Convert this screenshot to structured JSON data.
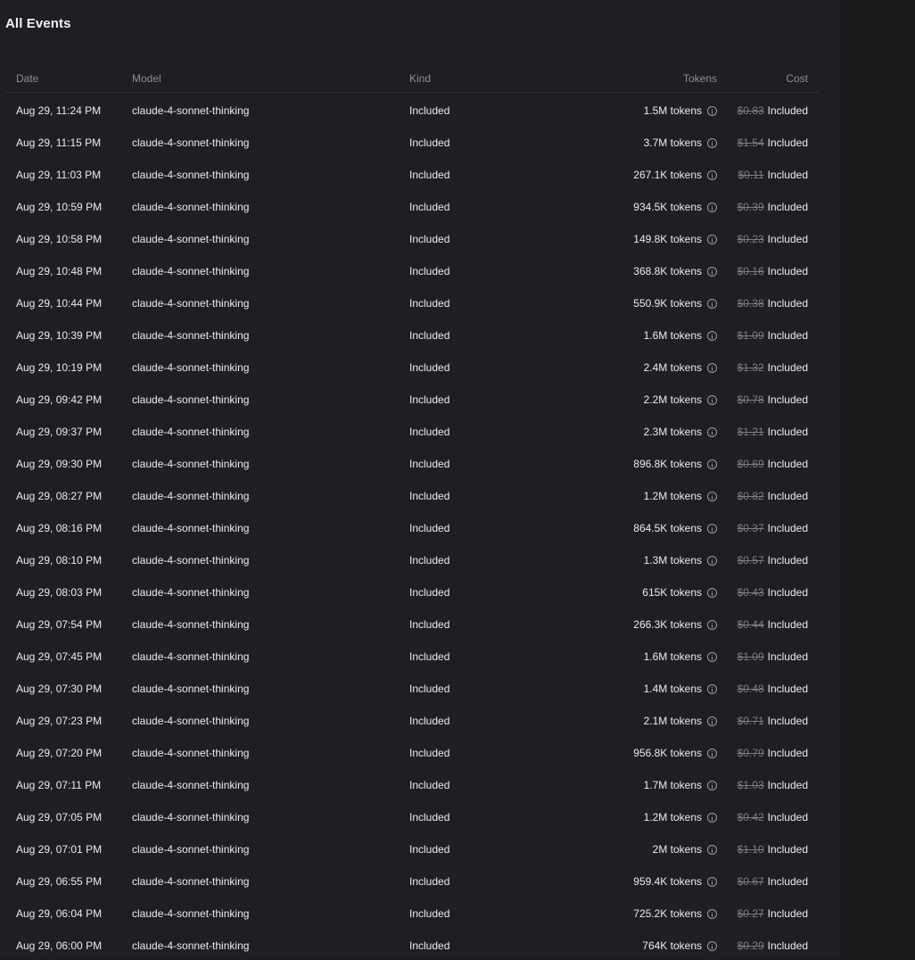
{
  "page": {
    "title": "All Events"
  },
  "table": {
    "headers": {
      "date": "Date",
      "model": "Model",
      "kind": "Kind",
      "tokens": "Tokens",
      "cost": "Cost"
    },
    "rows": [
      {
        "date": "Aug 29, 11:24 PM",
        "model": "claude-4-sonnet-thinking",
        "kind": "Included",
        "tokens": "1.5M tokens",
        "cost_struck": "$0.83",
        "cost_label": "Included"
      },
      {
        "date": "Aug 29, 11:15 PM",
        "model": "claude-4-sonnet-thinking",
        "kind": "Included",
        "tokens": "3.7M tokens",
        "cost_struck": "$1.54",
        "cost_label": "Included"
      },
      {
        "date": "Aug 29, 11:03 PM",
        "model": "claude-4-sonnet-thinking",
        "kind": "Included",
        "tokens": "267.1K tokens",
        "cost_struck": "$0.11",
        "cost_label": "Included"
      },
      {
        "date": "Aug 29, 10:59 PM",
        "model": "claude-4-sonnet-thinking",
        "kind": "Included",
        "tokens": "934.5K tokens",
        "cost_struck": "$0.39",
        "cost_label": "Included"
      },
      {
        "date": "Aug 29, 10:58 PM",
        "model": "claude-4-sonnet-thinking",
        "kind": "Included",
        "tokens": "149.8K tokens",
        "cost_struck": "$0.23",
        "cost_label": "Included"
      },
      {
        "date": "Aug 29, 10:48 PM",
        "model": "claude-4-sonnet-thinking",
        "kind": "Included",
        "tokens": "368.8K tokens",
        "cost_struck": "$0.16",
        "cost_label": "Included"
      },
      {
        "date": "Aug 29, 10:44 PM",
        "model": "claude-4-sonnet-thinking",
        "kind": "Included",
        "tokens": "550.9K tokens",
        "cost_struck": "$0.38",
        "cost_label": "Included"
      },
      {
        "date": "Aug 29, 10:39 PM",
        "model": "claude-4-sonnet-thinking",
        "kind": "Included",
        "tokens": "1.6M tokens",
        "cost_struck": "$1.09",
        "cost_label": "Included"
      },
      {
        "date": "Aug 29, 10:19 PM",
        "model": "claude-4-sonnet-thinking",
        "kind": "Included",
        "tokens": "2.4M tokens",
        "cost_struck": "$1.32",
        "cost_label": "Included"
      },
      {
        "date": "Aug 29, 09:42 PM",
        "model": "claude-4-sonnet-thinking",
        "kind": "Included",
        "tokens": "2.2M tokens",
        "cost_struck": "$0.78",
        "cost_label": "Included"
      },
      {
        "date": "Aug 29, 09:37 PM",
        "model": "claude-4-sonnet-thinking",
        "kind": "Included",
        "tokens": "2.3M tokens",
        "cost_struck": "$1.21",
        "cost_label": "Included"
      },
      {
        "date": "Aug 29, 09:30 PM",
        "model": "claude-4-sonnet-thinking",
        "kind": "Included",
        "tokens": "896.8K tokens",
        "cost_struck": "$0.69",
        "cost_label": "Included"
      },
      {
        "date": "Aug 29, 08:27 PM",
        "model": "claude-4-sonnet-thinking",
        "kind": "Included",
        "tokens": "1.2M tokens",
        "cost_struck": "$0.82",
        "cost_label": "Included"
      },
      {
        "date": "Aug 29, 08:16 PM",
        "model": "claude-4-sonnet-thinking",
        "kind": "Included",
        "tokens": "864.5K tokens",
        "cost_struck": "$0.37",
        "cost_label": "Included"
      },
      {
        "date": "Aug 29, 08:10 PM",
        "model": "claude-4-sonnet-thinking",
        "kind": "Included",
        "tokens": "1.3M tokens",
        "cost_struck": "$0.57",
        "cost_label": "Included"
      },
      {
        "date": "Aug 29, 08:03 PM",
        "model": "claude-4-sonnet-thinking",
        "kind": "Included",
        "tokens": "615K tokens",
        "cost_struck": "$0.43",
        "cost_label": "Included"
      },
      {
        "date": "Aug 29, 07:54 PM",
        "model": "claude-4-sonnet-thinking",
        "kind": "Included",
        "tokens": "266.3K tokens",
        "cost_struck": "$0.44",
        "cost_label": "Included"
      },
      {
        "date": "Aug 29, 07:45 PM",
        "model": "claude-4-sonnet-thinking",
        "kind": "Included",
        "tokens": "1.6M tokens",
        "cost_struck": "$1.09",
        "cost_label": "Included"
      },
      {
        "date": "Aug 29, 07:30 PM",
        "model": "claude-4-sonnet-thinking",
        "kind": "Included",
        "tokens": "1.4M tokens",
        "cost_struck": "$0.48",
        "cost_label": "Included"
      },
      {
        "date": "Aug 29, 07:23 PM",
        "model": "claude-4-sonnet-thinking",
        "kind": "Included",
        "tokens": "2.1M tokens",
        "cost_struck": "$0.71",
        "cost_label": "Included"
      },
      {
        "date": "Aug 29, 07:20 PM",
        "model": "claude-4-sonnet-thinking",
        "kind": "Included",
        "tokens": "956.8K tokens",
        "cost_struck": "$0.79",
        "cost_label": "Included"
      },
      {
        "date": "Aug 29, 07:11 PM",
        "model": "claude-4-sonnet-thinking",
        "kind": "Included",
        "tokens": "1.7M tokens",
        "cost_struck": "$1.03",
        "cost_label": "Included"
      },
      {
        "date": "Aug 29, 07:05 PM",
        "model": "claude-4-sonnet-thinking",
        "kind": "Included",
        "tokens": "1.2M tokens",
        "cost_struck": "$0.42",
        "cost_label": "Included"
      },
      {
        "date": "Aug 29, 07:01 PM",
        "model": "claude-4-sonnet-thinking",
        "kind": "Included",
        "tokens": "2M tokens",
        "cost_struck": "$1.10",
        "cost_label": "Included"
      },
      {
        "date": "Aug 29, 06:55 PM",
        "model": "claude-4-sonnet-thinking",
        "kind": "Included",
        "tokens": "959.4K tokens",
        "cost_struck": "$0.67",
        "cost_label": "Included"
      },
      {
        "date": "Aug 29, 06:04 PM",
        "model": "claude-4-sonnet-thinking",
        "kind": "Included",
        "tokens": "725.2K tokens",
        "cost_struck": "$0.27",
        "cost_label": "Included"
      },
      {
        "date": "Aug 29, 06:00 PM",
        "model": "claude-4-sonnet-thinking",
        "kind": "Included",
        "tokens": "764K tokens",
        "cost_struck": "$0.29",
        "cost_label": "Included"
      }
    ]
  }
}
